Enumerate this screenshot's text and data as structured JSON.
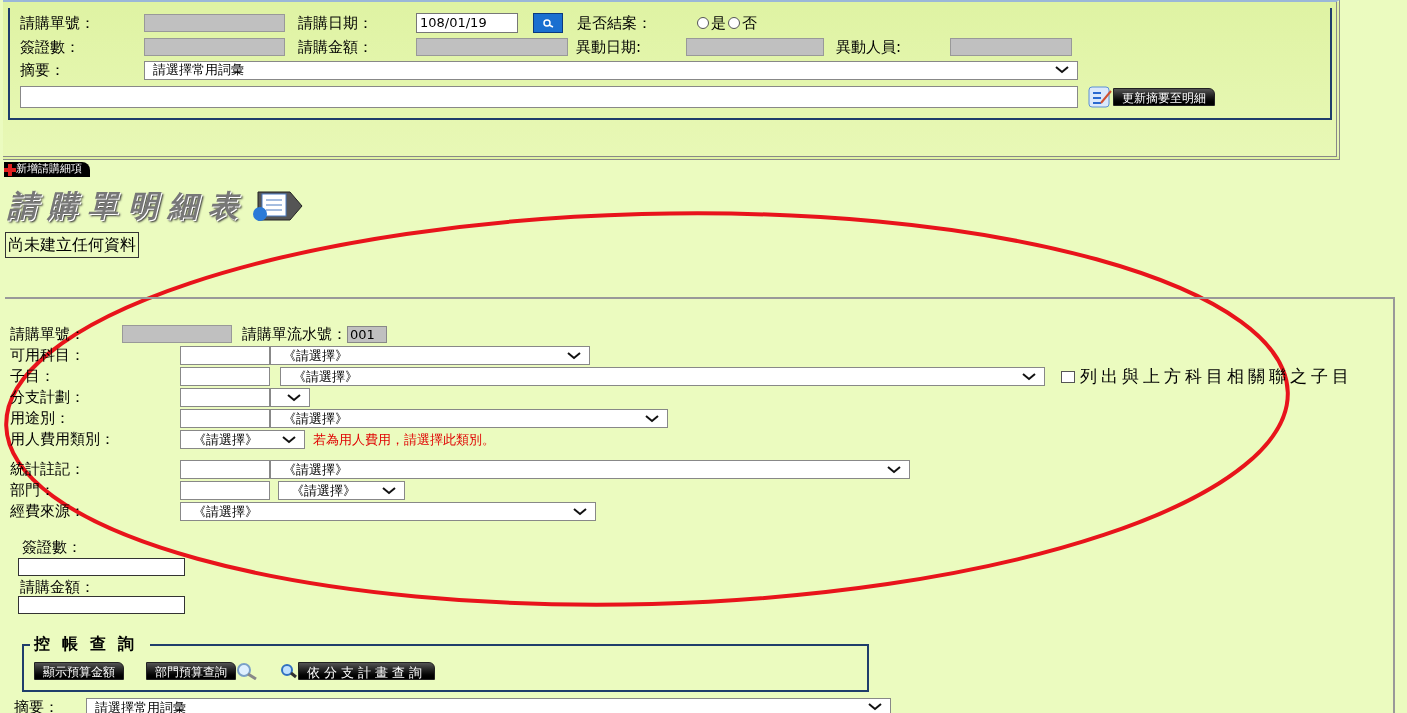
{
  "header": {
    "order_no": {
      "label": "請購單號："
    },
    "date": {
      "label": "請購日期：",
      "value": "108/01/19"
    },
    "closed": {
      "label": "是否結案：",
      "options": [
        {
          "label": "是",
          "selected": false
        },
        {
          "label": "否",
          "selected": false
        }
      ]
    },
    "visa_count": {
      "label": "簽證數："
    },
    "amount": {
      "label": "請購金額："
    },
    "change_date": {
      "label": "異動日期:"
    },
    "change_person": {
      "label": "異動人員:"
    },
    "summary": {
      "label": "摘要：",
      "value": "請選擇常用詞彙"
    },
    "update_button": "更新摘要至明細"
  },
  "add_item_button": "新增請購細項",
  "detail_title": "請購單明細表",
  "empty_message": "尚未建立任何資料",
  "detail_form": {
    "order_no_label": "請購單號：",
    "serial_label": "請購單流水號：",
    "serial_value": "001",
    "rows": [
      {
        "kind": "code_select",
        "label": "可用科目：",
        "value": "《請選擇》"
      },
      {
        "kind": "code_select",
        "label": "子目：",
        "value": "《請選擇》",
        "checkbox": {
          "label": "列出與上方科目相關聯之子目",
          "checked": false
        }
      },
      {
        "kind": "code_select",
        "label": "分支計劃："
      },
      {
        "kind": "code_select",
        "label": "用途別：",
        "value": "《請選擇》"
      },
      {
        "kind": "select",
        "label": "用人費用類別：",
        "value": "《請選擇》",
        "note": "若為用人費用，請選擇此類別。"
      },
      {
        "kind": "code_select",
        "label": "統計註記：",
        "value": "《請選擇》"
      },
      {
        "kind": "code_select",
        "label": "部門：",
        "value": "《請選擇》"
      },
      {
        "kind": "select",
        "label": "經費來源：",
        "value": "《請選擇》"
      }
    ],
    "visa_count_label": "簽證數：",
    "amount_label": "請購金額："
  },
  "budget_query": {
    "legend": "控帳查詢",
    "buttons": [
      "顯示預算金額",
      "部門預算查詢",
      "依分支計畫查詢"
    ]
  },
  "bottom_summary": {
    "label": "摘要：",
    "value": "請選擇常用詞彙"
  }
}
